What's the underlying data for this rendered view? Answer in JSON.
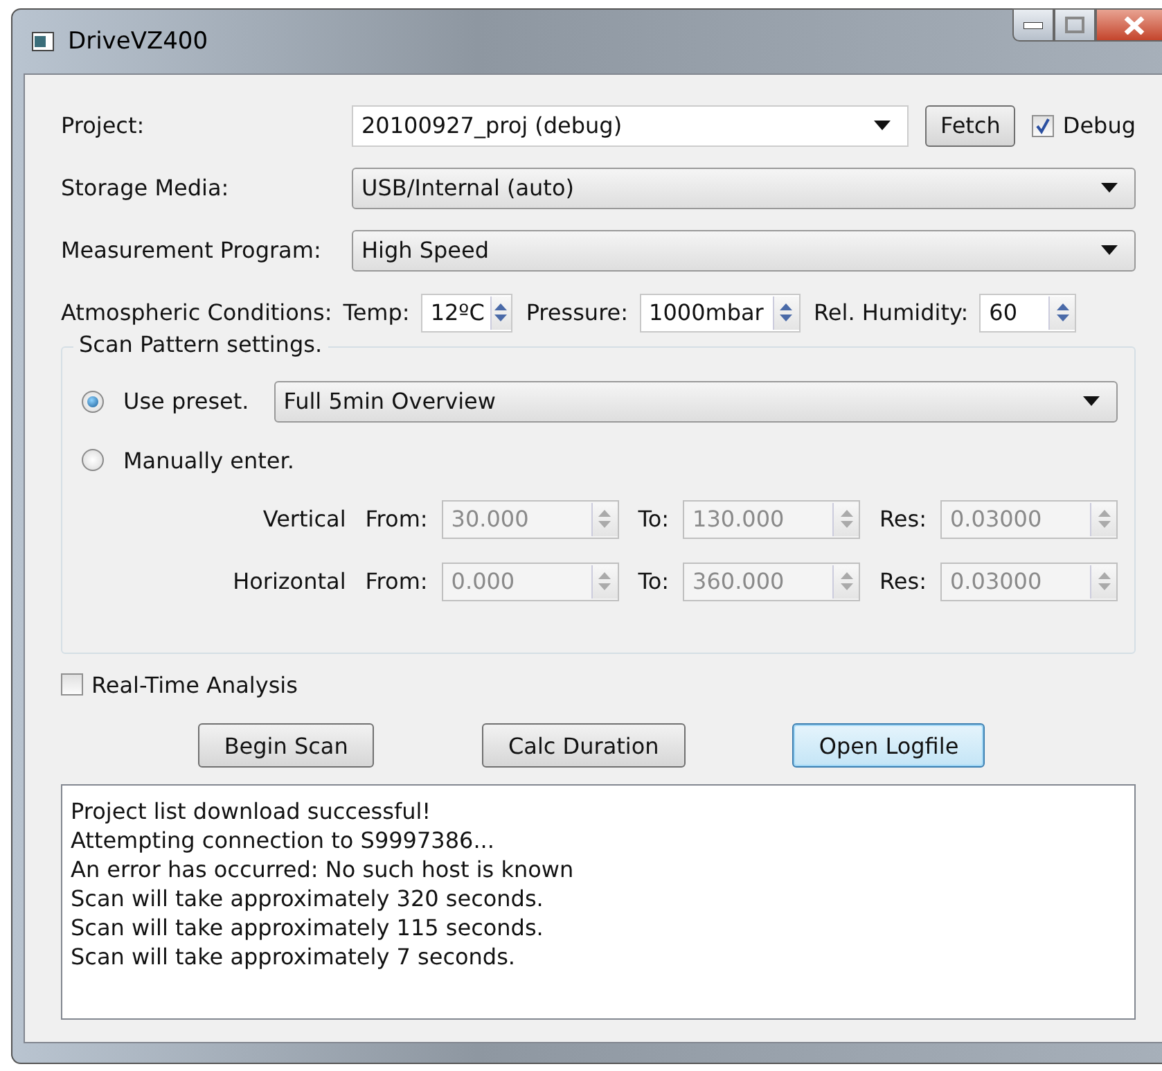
{
  "window": {
    "title": "DriveVZ400"
  },
  "project": {
    "label": "Project:",
    "value": "20100927_proj (debug)",
    "fetch_button": "Fetch",
    "debug": {
      "label": "Debug",
      "checked": true
    }
  },
  "storage_media": {
    "label": "Storage Media:",
    "value": "USB/Internal (auto)"
  },
  "measurement_program": {
    "label": "Measurement Program:",
    "value": "High Speed"
  },
  "atmospheric": {
    "label": "Atmospheric Conditions:",
    "fields": [
      {
        "label": "Temp:",
        "value": "12ºC"
      },
      {
        "label": "Pressure:",
        "value": "1000mbar"
      },
      {
        "label": "Rel. Humidity:",
        "value": "60"
      }
    ]
  },
  "scan_pattern": {
    "title": "Scan Pattern settings.",
    "options": [
      {
        "label": "Use preset.",
        "selected": true
      },
      {
        "label": "Manually enter.",
        "selected": false
      }
    ],
    "preset": "Full 5min Overview",
    "manual_disabled": true,
    "rows": [
      {
        "label": "Vertical",
        "fields": [
          {
            "label": "From:",
            "value": "30.000"
          },
          {
            "label": "To:",
            "value": "130.000"
          },
          {
            "label": "Res:",
            "value": "0.03000"
          }
        ]
      },
      {
        "label": "Horizontal",
        "fields": [
          {
            "label": "From:",
            "value": "0.000"
          },
          {
            "label": "To:",
            "value": "360.000"
          },
          {
            "label": "Res:",
            "value": "0.03000"
          }
        ]
      }
    ]
  },
  "real_time_analysis": {
    "label": "Real-Time Analysis",
    "checked": false
  },
  "buttons": [
    {
      "label": "Begin Scan",
      "focused": false
    },
    {
      "label": "Calc Duration",
      "focused": false
    },
    {
      "label": "Open Logfile",
      "focused": true
    }
  ],
  "log": [
    "Project list download successful!",
    "Attempting connection to S9997386...",
    "An error has occurred: No such host is known",
    "Scan will take approximately 320 seconds.",
    "Scan will take approximately 115 seconds.",
    "Scan will take approximately 7 seconds."
  ]
}
